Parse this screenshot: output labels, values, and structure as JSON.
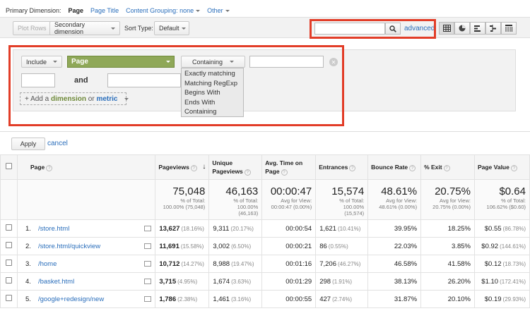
{
  "dimension_bar": {
    "label": "Primary Dimension:",
    "current": "Page",
    "options": [
      "Page Title",
      "Content Grouping: none",
      "Other"
    ]
  },
  "toolbar": {
    "plot_rows": "Plot Rows",
    "secondary_dimension": "Secondary dimension",
    "sort_type_label": "Sort Type:",
    "sort_type_value": "Default",
    "search_value": "",
    "advanced": "advanced"
  },
  "filter": {
    "include": "Include",
    "dimension": "Page",
    "match_type": "Containing",
    "value": "",
    "match_options": [
      "Exactly matching",
      "Matching RegExp",
      "Begins With",
      "Ends With",
      "Containing"
    ],
    "and_label": "and",
    "add_prefix": "+ Add a ",
    "add_dimension": "dimension",
    "add_or": " or ",
    "add_metric": "metric",
    "apply": "Apply",
    "cancel": "cancel"
  },
  "table": {
    "headers": [
      "Page",
      "Pageviews",
      "Unique Pageviews",
      "Avg. Time on Page",
      "Entrances",
      "Bounce Rate",
      "% Exit",
      "Page Value"
    ],
    "totals": [
      {
        "big": "75,048",
        "sub1": "% of Total:",
        "sub2": "100.00% (75,048)"
      },
      {
        "big": "46,163",
        "sub1": "% of Total:",
        "sub2": "100.00%",
        "sub3": "(46,163)"
      },
      {
        "big": "00:00:47",
        "sub1": "Avg for View:",
        "sub2": "00:00:47 (0.00%)"
      },
      {
        "big": "15,574",
        "sub1": "% of Total:",
        "sub2": "100.00%",
        "sub3": "(15,574)"
      },
      {
        "big": "48.61%",
        "sub1": "Avg for View:",
        "sub2": "48.61% (0.00%)"
      },
      {
        "big": "20.75%",
        "sub1": "Avg for View:",
        "sub2": "20.75% (0.00%)"
      },
      {
        "big": "$0.64",
        "sub1": "% of Total:",
        "sub2": "106.62% ($0.60)"
      }
    ],
    "rows": [
      {
        "idx": "1.",
        "page": "/store.html",
        "pv": "13,627",
        "pv_pct": "(18.16%)",
        "upv": "9,311",
        "upv_pct": "(20.17%)",
        "time": "00:00:54",
        "ent": "1,621",
        "ent_pct": "(10.41%)",
        "bounce": "39.95%",
        "exit": "18.25%",
        "val": "$0.55",
        "val_pct": "(86.78%)"
      },
      {
        "idx": "2.",
        "page": "/store.html/quickview",
        "pv": "11,691",
        "pv_pct": "(15.58%)",
        "upv": "3,002",
        "upv_pct": "(6.50%)",
        "time": "00:00:21",
        "ent": "86",
        "ent_pct": "(0.55%)",
        "bounce": "22.03%",
        "exit": "3.85%",
        "val": "$0.92",
        "val_pct": "(144.61%)"
      },
      {
        "idx": "3.",
        "page": "/home",
        "pv": "10,712",
        "pv_pct": "(14.27%)",
        "upv": "8,988",
        "upv_pct": "(19.47%)",
        "time": "00:01:16",
        "ent": "7,206",
        "ent_pct": "(46.27%)",
        "bounce": "46.58%",
        "exit": "41.58%",
        "val": "$0.12",
        "val_pct": "(18.73%)"
      },
      {
        "idx": "4.",
        "page": "/basket.html",
        "pv": "3,715",
        "pv_pct": "(4.95%)",
        "upv": "1,674",
        "upv_pct": "(3.63%)",
        "time": "00:01:29",
        "ent": "298",
        "ent_pct": "(1.91%)",
        "bounce": "38.13%",
        "exit": "26.20%",
        "val": "$1.10",
        "val_pct": "(172.41%)"
      },
      {
        "idx": "5.",
        "page": "/google+redesign/new",
        "pv": "1,786",
        "pv_pct": "(2.38%)",
        "upv": "1,461",
        "upv_pct": "(3.16%)",
        "time": "00:00:55",
        "ent": "427",
        "ent_pct": "(2.74%)",
        "bounce": "31.87%",
        "exit": "20.10%",
        "val": "$0.19",
        "val_pct": "(29.93%)"
      }
    ]
  }
}
